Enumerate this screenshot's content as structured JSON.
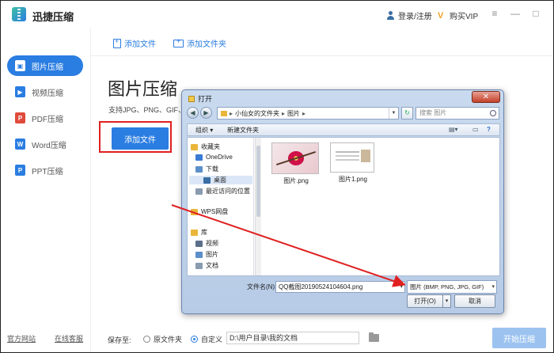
{
  "app": {
    "title": "迅捷压缩",
    "login_label": "登录/注册",
    "vip_label": "购买VIP",
    "controls": [
      "≡",
      "—",
      "□",
      "✕"
    ]
  },
  "sidebar": {
    "items": [
      {
        "label": "图片压缩",
        "icon": "image-icon",
        "icon_glyph": "▣",
        "active": true
      },
      {
        "label": "视频压缩",
        "icon": "video-icon",
        "icon_glyph": "▶",
        "active": false
      },
      {
        "label": "PDF压缩",
        "icon": "pdf-icon",
        "icon_glyph": "P",
        "active": false
      },
      {
        "label": "Word压缩",
        "icon": "word-icon",
        "icon_glyph": "W",
        "active": false
      },
      {
        "label": "PPT压缩",
        "icon": "ppt-icon",
        "icon_glyph": "P",
        "active": false
      }
    ],
    "footer_left": "官方网站",
    "footer_right": "在线客服"
  },
  "toolbar": {
    "add_file": "添加文件",
    "add_folder": "添加文件夹"
  },
  "main": {
    "title": "图片压缩",
    "subtitle": "支持JPG、PNG、GIF、B",
    "add_button": "添加文件"
  },
  "bottombar": {
    "save_label": "保存至:",
    "option_original": "原文件夹",
    "option_custom": "自定义",
    "selected_option": "custom",
    "path_value": "D:\\用户目录\\我的文档",
    "start_button": "开始压缩"
  },
  "dialog": {
    "title": "打开",
    "close": "✕",
    "breadcrumbs": [
      "小仙女的文件夹",
      "图片"
    ],
    "search_placeholder": "搜索 图片",
    "commands": {
      "organize": "组织 ▾",
      "new_folder": "新建文件夹"
    },
    "nav": [
      {
        "label": "收藏夹",
        "icon": "star-icon",
        "color": "#e9b63a"
      },
      {
        "label": "OneDrive",
        "icon": "cloud-icon",
        "color": "#3a7bd5"
      },
      {
        "label": "下载",
        "icon": "download-icon",
        "color": "#5a8fc9"
      },
      {
        "label": "桌面",
        "icon": "desktop-icon",
        "color": "#3a6ea5",
        "selected": true
      },
      {
        "label": "最近访问的位置",
        "icon": "recent-icon",
        "color": "#8a9bb0"
      },
      {
        "label": "WPS网盘",
        "icon": "wps-drive-icon",
        "color": "#e9b63a"
      },
      {
        "label": "库",
        "icon": "library-icon",
        "color": "#e9b63a"
      },
      {
        "label": "视频",
        "icon": "video-folder-icon",
        "color": "#5a6f8a"
      },
      {
        "label": "图片",
        "icon": "picture-folder-icon",
        "color": "#5a8fc9"
      },
      {
        "label": "文档",
        "icon": "document-folder-icon",
        "color": "#8a9bb0"
      }
    ],
    "files": [
      {
        "name": "图片.png",
        "kind": "photo"
      },
      {
        "name": "图片1.png",
        "kind": "doc"
      }
    ],
    "filename_label": "文件名(N):",
    "filename_value": "QQ截图20190524104604.png",
    "filter_value": "图片 (BMP, PNG, JPG, GIF)",
    "open_button": "打开(O)",
    "cancel_button": "取消"
  }
}
